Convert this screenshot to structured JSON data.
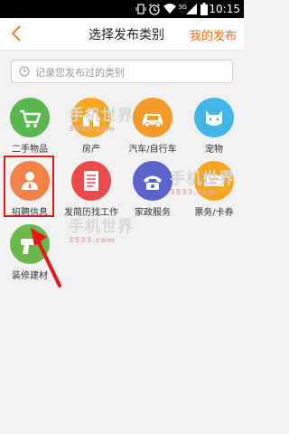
{
  "status_bar": {
    "signal": "3G",
    "time": "10:15"
  },
  "header": {
    "back_icon": "chevron-left-icon",
    "title": "选择发布类别",
    "my_posts": "我的发布"
  },
  "search": {
    "icon": "clock-icon",
    "placeholder": "记录您发布过的类别"
  },
  "categories": [
    {
      "label": "二手物品",
      "icon": "cart-icon",
      "color": "#59b84d"
    },
    {
      "label": "房产",
      "icon": "house-icon",
      "color": "#f5a623"
    },
    {
      "label": "汽车/自行车",
      "icon": "car-icon",
      "color": "#f29b2a"
    },
    {
      "label": "宠物",
      "icon": "cat-icon",
      "color": "#3fb6e6"
    },
    {
      "label": "招聘信息",
      "icon": "person-icon",
      "color": "#f2814a"
    },
    {
      "label": "发简历找工作",
      "icon": "resume-icon",
      "color": "#ea4a4a"
    },
    {
      "label": "家政服务",
      "icon": "phone-icon",
      "color": "#5b63c9"
    },
    {
      "label": "票务/卡券",
      "icon": "ticket-icon",
      "color": "#f5a623"
    },
    {
      "label": "装修建材",
      "icon": "drill-icon",
      "color": "#6bb84c"
    }
  ],
  "watermark": {
    "text": "手机世界",
    "sub": "3533.com"
  },
  "annotation_color": "#e8151b"
}
